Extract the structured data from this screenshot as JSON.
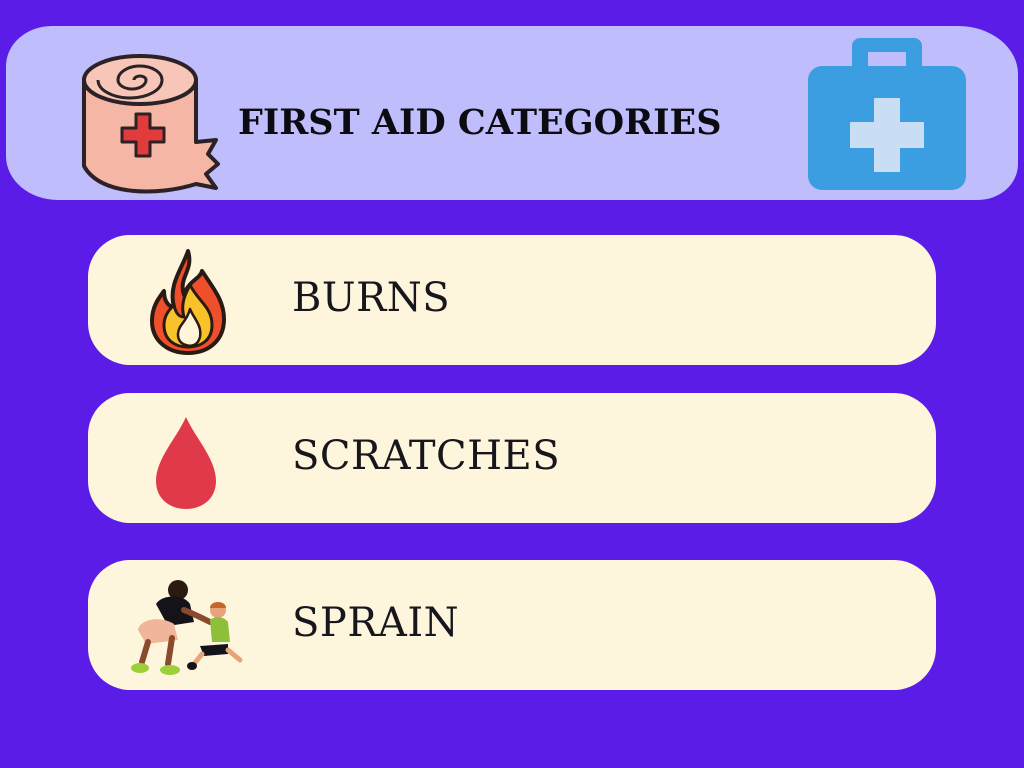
{
  "header": {
    "title": "FIRST AID CATEGORIES",
    "left_icon": "bandage-roll-icon",
    "right_icon": "first-aid-kit-icon"
  },
  "categories": [
    {
      "label": "BURNS",
      "icon": "fire-icon"
    },
    {
      "label": "SCRATCHES",
      "icon": "blood-drop-icon"
    },
    {
      "label": "SPRAIN",
      "icon": "adult-helping-child-illustration"
    }
  ],
  "colors": {
    "background": "#5b1ce8",
    "header": "#bfbdfb",
    "card": "#fdf6dc",
    "kit": "#3a9ee0",
    "drop": "#e03a4a"
  }
}
